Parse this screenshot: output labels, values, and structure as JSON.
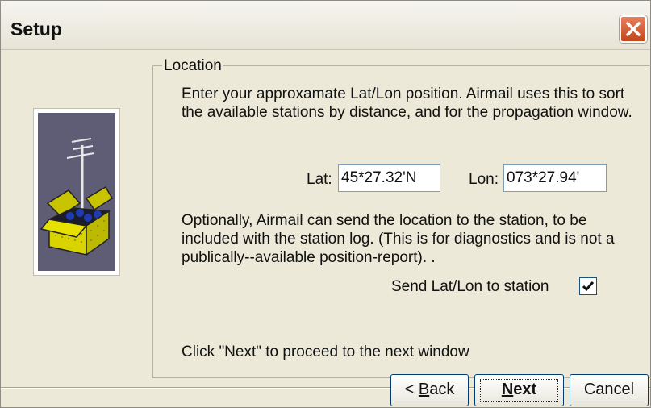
{
  "window": {
    "title": "Setup"
  },
  "group": {
    "legend": "Location",
    "description": "Enter your approxamate Lat/Lon position. Airmail uses this to sort the available stations by distance, and for the propagation window.",
    "lat_label": "Lat:",
    "lat_value": "45*27.32'N",
    "lon_label": "Lon:",
    "lon_value": "073*27.94'",
    "optional_text": "Optionally, Airmail can send the location to the station, to be included with the station log. (This is for diagnostics and is not a publically--available position-report). .",
    "send_label": "Send Lat/Lon to station",
    "send_checked": true,
    "next_hint": "Click \"Next\" to proceed to the next window"
  },
  "buttons": {
    "back_prefix": "< ",
    "back_key": "B",
    "back_rest": "ack",
    "next_key": "N",
    "next_rest": "ext",
    "cancel": "Cancel"
  },
  "colors": {
    "dialog_bg": "#ece9d8",
    "close_red": "#c2451d",
    "art_bg": "#5f5d75",
    "box_yellow": "#d9d400"
  },
  "icons": {
    "close": "close-icon",
    "check": "checkmark-icon",
    "illustration": "antenna-mailbox-illustration"
  }
}
